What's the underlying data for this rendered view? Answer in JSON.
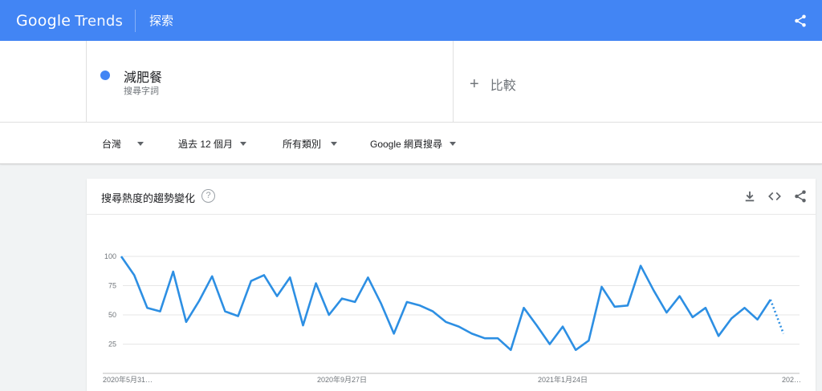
{
  "header": {
    "logo_google": "Google",
    "logo_trends": "Trends",
    "explore_label": "探索",
    "share_icon": "share-icon",
    "bar_color": "#4285f4"
  },
  "search_term": {
    "name": "減肥餐",
    "type": "搜尋字詞",
    "color": "#4285f4"
  },
  "compare": {
    "plus": "+",
    "label": "比較"
  },
  "filters": [
    {
      "label": "台灣"
    },
    {
      "label": "過去 12 個月"
    },
    {
      "label": "所有類別"
    },
    {
      "label": "Google 網頁搜尋"
    }
  ],
  "card": {
    "title": "搜尋熱度的趨勢變化",
    "help": "?",
    "icons": [
      "download-icon",
      "embed-icon",
      "share-icon"
    ]
  },
  "chart_data": {
    "type": "line",
    "title": "",
    "xlabel": "",
    "ylabel": "",
    "yticks": [
      25,
      50,
      75,
      100
    ],
    "ylim": [
      0,
      100
    ],
    "x_tick_labels": [
      "2020年5月31…",
      "2020年9月27日",
      "2021年1月24日",
      "202…"
    ],
    "x_tick_indices": [
      0,
      17,
      34,
      51
    ],
    "line_color": "#2d8fe3",
    "grid": true,
    "series": [
      {
        "values": [
          100,
          84,
          56,
          53,
          87,
          44,
          62,
          83,
          53,
          49,
          79,
          84,
          66,
          82,
          41,
          77,
          50,
          64,
          61,
          82,
          60,
          34,
          61,
          58,
          53,
          44,
          40,
          34,
          30,
          30,
          20,
          56,
          41,
          25,
          40,
          20,
          28,
          74,
          57,
          58,
          92,
          71,
          52,
          66,
          48,
          56,
          32,
          47,
          56,
          46,
          63,
          34
        ],
        "partial_from_index": 50
      }
    ]
  }
}
